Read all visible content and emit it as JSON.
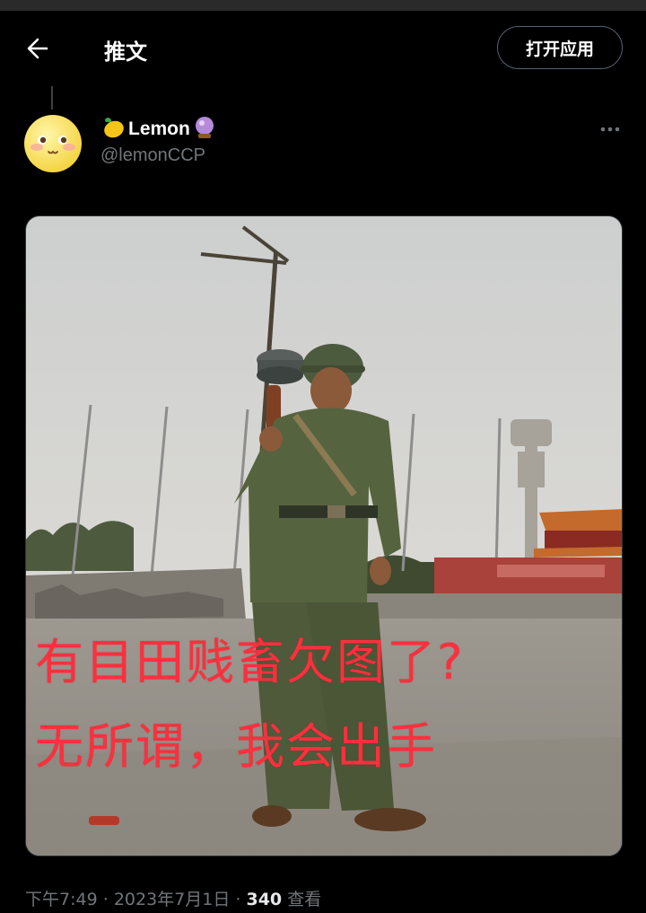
{
  "header": {
    "title": "推文",
    "open_app_label": "打开应用",
    "back_icon": "arrow-left-icon"
  },
  "tweet": {
    "display_name": "Lemon",
    "name_emoji_left": "lemon-icon",
    "name_emoji_right": "crystal-ball-icon",
    "handle": "@lemonCCP",
    "more_icon": "ellipsis-icon",
    "image_text_line1": "有目田贱畜欠图了?",
    "image_text_line2": "无所谓，我会出手",
    "time": "下午7:49",
    "separator": "·",
    "date": "2023年7月1日",
    "views_count": "340",
    "views_label": "查看"
  },
  "colors": {
    "background": "#000000",
    "secondary_text": "#71767b",
    "overlay_text": "#ff2f3e"
  }
}
